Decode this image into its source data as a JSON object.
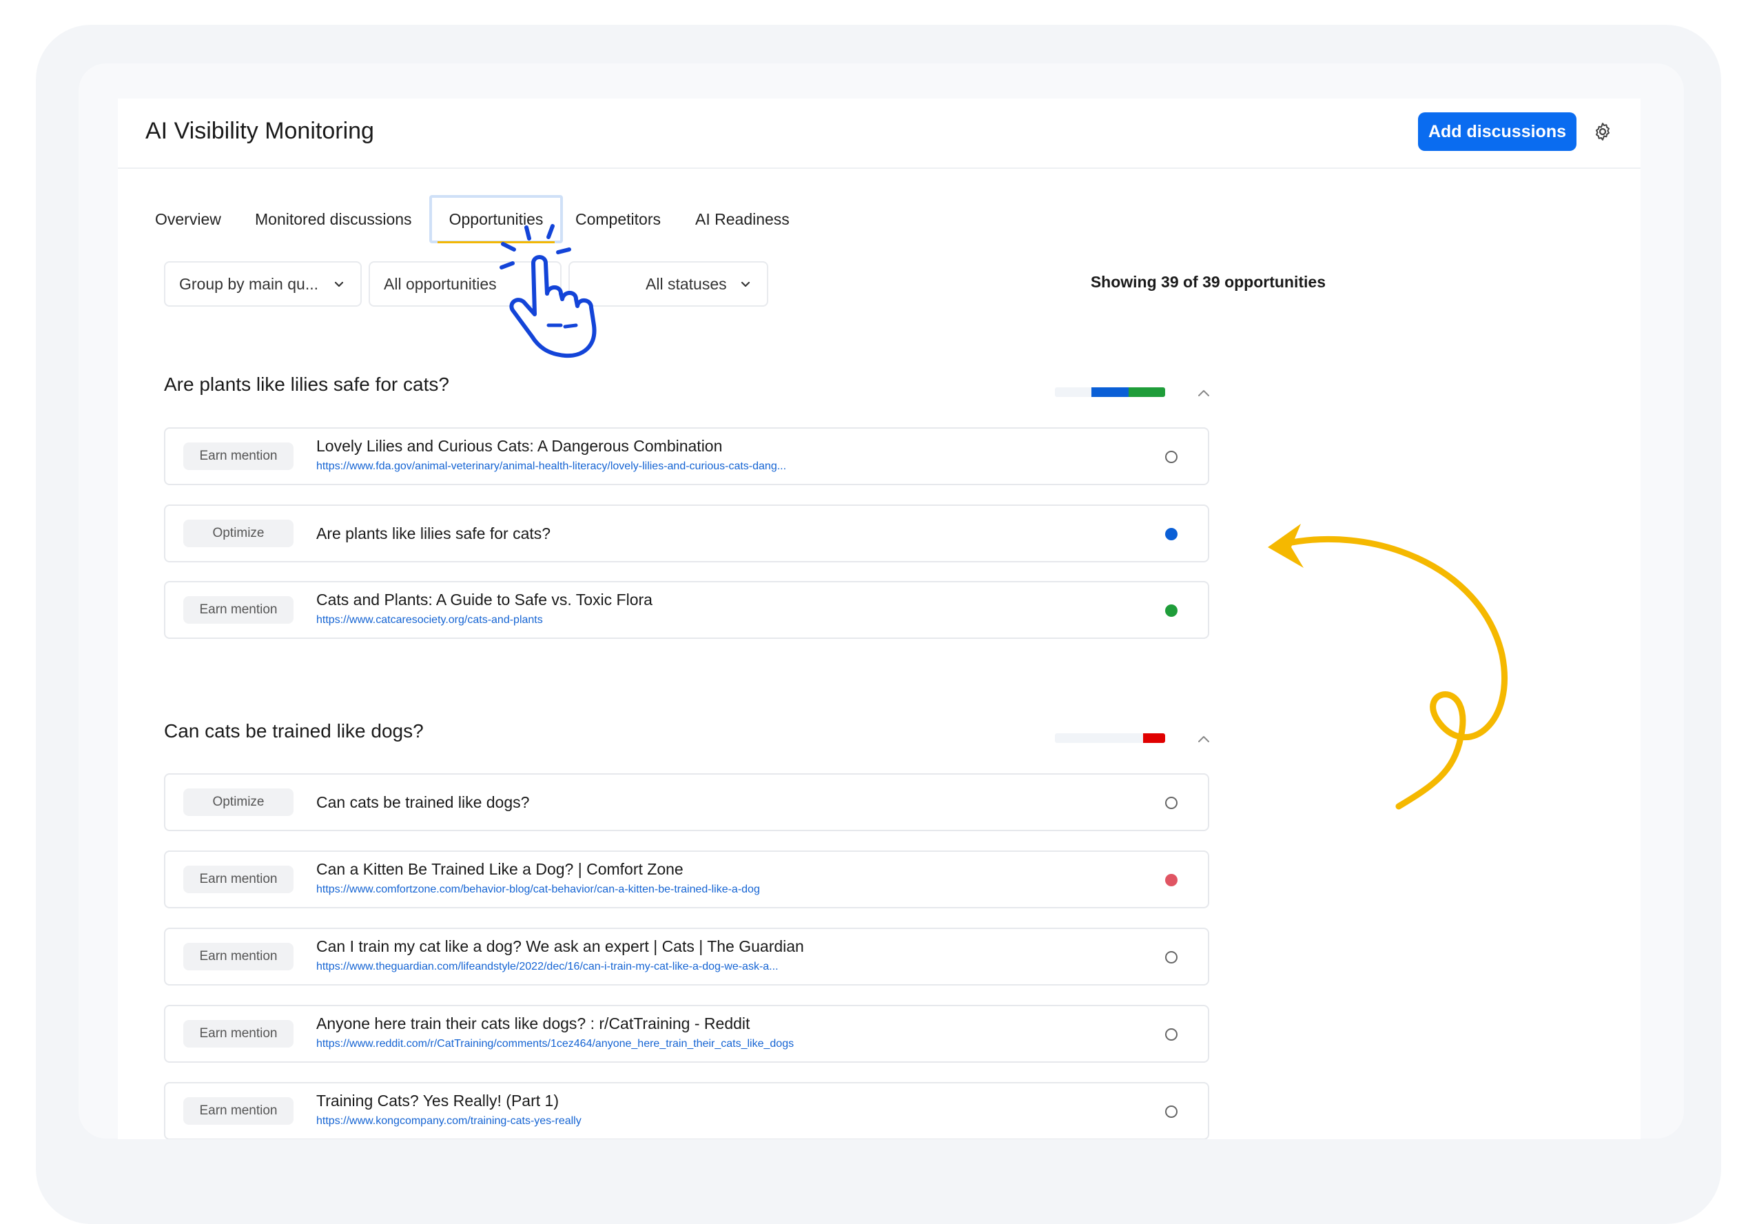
{
  "header": {
    "title": "AI Visibility Monitoring",
    "add_button": "Add discussions"
  },
  "tabs": [
    {
      "label": "Overview"
    },
    {
      "label": "Monitored discussions"
    },
    {
      "label": "Opportunities",
      "active": true
    },
    {
      "label": "Competitors"
    },
    {
      "label": "AI Readiness"
    }
  ],
  "filters": {
    "group_by": "Group by main qu...",
    "type": "All opportunities",
    "status": "All statuses"
  },
  "showing_text": "Showing 39 of 39 opportunities",
  "colors": {
    "accent": "#0a6cf0",
    "status_blue": "#0a5fd6",
    "status_green": "#1f9d3a",
    "status_red": "#e05563",
    "highlight_yellow": "#f5b800"
  },
  "groups": [
    {
      "title": "Are plants like lilies safe for cats?",
      "rows": [
        {
          "type": "Earn mention",
          "title": "Lovely Lilies and Curious Cats: A Dangerous Combination",
          "url": "https://www.fda.gov/animal-veterinary/animal-health-literacy/lovely-lilies-and-curious-cats-dang...",
          "status": "empty"
        },
        {
          "type": "Optimize",
          "title": "Are plants like lilies safe for cats?",
          "url": "",
          "status": "blue"
        },
        {
          "type": "Earn mention",
          "title": "Cats and Plants: A Guide to Safe vs. Toxic Flora",
          "url": "https://www.catcaresociety.org/cats-and-plants",
          "status": "green"
        }
      ]
    },
    {
      "title": "Can cats be trained like dogs?",
      "rows": [
        {
          "type": "Optimize",
          "title": "Can cats be trained like dogs?",
          "url": "",
          "status": "empty"
        },
        {
          "type": "Earn mention",
          "title": "Can a Kitten Be Trained Like a Dog? | Comfort Zone",
          "url": "https://www.comfortzone.com/behavior-blog/cat-behavior/can-a-kitten-be-trained-like-a-dog",
          "status": "red"
        },
        {
          "type": "Earn mention",
          "title": "Can I train my cat like a dog? We ask an expert | Cats | The Guardian",
          "url": "https://www.theguardian.com/lifeandstyle/2022/dec/16/can-i-train-my-cat-like-a-dog-we-ask-a...",
          "status": "empty"
        },
        {
          "type": "Earn mention",
          "title": "Anyone here train their cats like dogs? : r/CatTraining - Reddit",
          "url": "https://www.reddit.com/r/CatTraining/comments/1cez464/anyone_here_train_their_cats_like_dogs",
          "status": "empty"
        },
        {
          "type": "Earn mention",
          "title": "Training Cats? Yes Really! (Part 1)",
          "url": "https://www.kongcompany.com/training-cats-yes-really",
          "status": "empty"
        }
      ]
    }
  ]
}
